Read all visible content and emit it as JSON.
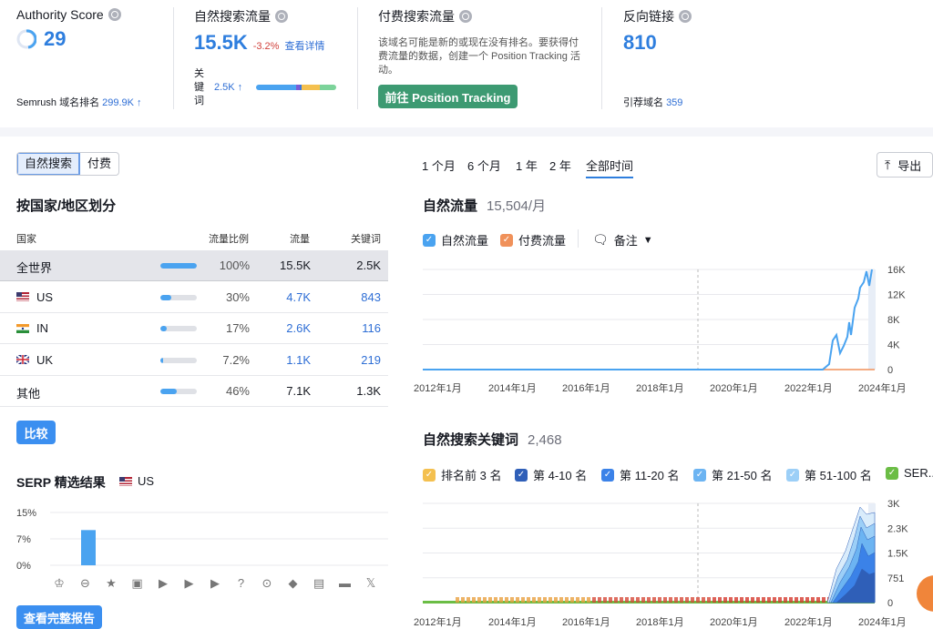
{
  "top": {
    "authority": {
      "label": "Authority Score",
      "value": "29",
      "rank_label": "Semrush 域名排名",
      "rank_value": "299.9K ↑"
    },
    "organic": {
      "label": "自然搜索流量",
      "value": "15.5K",
      "change": "-3.2%",
      "details": "查看详情",
      "kw_label": "关键词",
      "kw_value": "2.5K ↑"
    },
    "paid": {
      "label": "付费搜索流量",
      "desc": "该域名可能是新的或现在没有排名。要获得付费流量的数据，创建一个 Position Tracking 活动。",
      "button": "前往 Position Tracking"
    },
    "backlinks": {
      "label": "反向链接",
      "value": "810",
      "ref_label": "引荐域名",
      "ref_value": "359"
    }
  },
  "left": {
    "seg": [
      "自然搜索",
      "付费"
    ],
    "country_title": "按国家/地区划分",
    "headers": [
      "国家",
      "流量比例",
      "流量",
      "关键词"
    ],
    "rows": [
      {
        "name": "全世界",
        "pct": "100%",
        "share": 1.0,
        "traffic": "15.5K",
        "kw": "2.5K",
        "flag": ""
      },
      {
        "name": "US",
        "pct": "30%",
        "share": 0.3,
        "traffic": "4.7K",
        "kw": "843",
        "flag": "us"
      },
      {
        "name": "IN",
        "pct": "17%",
        "share": 0.17,
        "traffic": "2.6K",
        "kw": "116",
        "flag": "in"
      },
      {
        "name": "UK",
        "pct": "7.2%",
        "share": 0.072,
        "traffic": "1.1K",
        "kw": "219",
        "flag": "uk"
      },
      {
        "name": "其他",
        "pct": "46%",
        "share": 0.46,
        "traffic": "7.1K",
        "kw": "1.3K",
        "flag": ""
      }
    ],
    "compare": "比较",
    "serp_title": "SERP 精选结果",
    "serp_country": "US",
    "serp_y": [
      "15%",
      "7%",
      "0%"
    ],
    "full_report": "查看完整报告"
  },
  "right": {
    "periods": [
      "1 个月",
      "6 个月",
      "1 年",
      "2 年",
      "全部时间"
    ],
    "export": "导出",
    "traffic_title": "自然流量",
    "traffic_value": "15,504/月",
    "legend1": [
      "自然流量",
      "付费流量"
    ],
    "notes": "备注",
    "kw_title": "自然搜索关键词",
    "kw_value": "2,468",
    "legend2": [
      "排名前 3 名",
      "第 4-10 名",
      "第 11-20 名",
      "第 21-50 名",
      "第 51-100 名",
      "SER..."
    ],
    "colors": {
      "accent": "#2e7ede",
      "green": "#3d9a72",
      "blue": "#4aa3f0",
      "orange": "#f0915a"
    }
  },
  "chart_data": [
    {
      "type": "line",
      "title": "自然流量",
      "x": [
        "2012年1月",
        "2014年1月",
        "2016年1月",
        "2018年1月",
        "2020年1月",
        "2022年1月",
        "2024年1月"
      ],
      "series": [
        {
          "name": "自然流量",
          "values": [
            0,
            0,
            0,
            0,
            0,
            100,
            15500
          ]
        },
        {
          "name": "付费流量",
          "values": [
            0,
            0,
            0,
            0,
            0,
            0,
            0
          ]
        }
      ],
      "yticks": [
        "16K",
        "12K",
        "8K",
        "4K",
        "0"
      ],
      "ylim": [
        0,
        16000
      ]
    },
    {
      "type": "area",
      "title": "自然搜索关键词",
      "x": [
        "2012年1月",
        "2014年1月",
        "2016年1月",
        "2018年1月",
        "2020年1月",
        "2022年1月",
        "2024年1月"
      ],
      "yticks": [
        "3K",
        "2.3K",
        "1.5K",
        "751",
        "0"
      ],
      "ylim": [
        0,
        3000
      ]
    },
    {
      "type": "bar",
      "title": "SERP 精选结果",
      "values": [
        0,
        10,
        0,
        0,
        0,
        0,
        0,
        0,
        0,
        0,
        0,
        0,
        0,
        0
      ],
      "yticks": [
        "15%",
        "7%",
        "0%"
      ]
    }
  ]
}
